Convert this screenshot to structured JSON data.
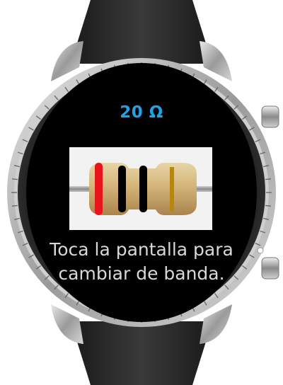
{
  "display": {
    "resistance_label": "20 Ω",
    "instruction_line1": "Toca la pantalla para",
    "instruction_line2": "cambiar de banda."
  },
  "resistor": {
    "bands": [
      {
        "color": "#e8141b",
        "name": "red"
      },
      {
        "color": "#000000",
        "name": "black"
      },
      {
        "color": "#000000",
        "name": "black"
      }
    ],
    "tolerance_band_color": "#b8860b",
    "body_color": "#d9c08a"
  },
  "colors": {
    "accent": "#1fa2e6",
    "screen_bg": "#000000",
    "text": "#d8d8d8"
  }
}
